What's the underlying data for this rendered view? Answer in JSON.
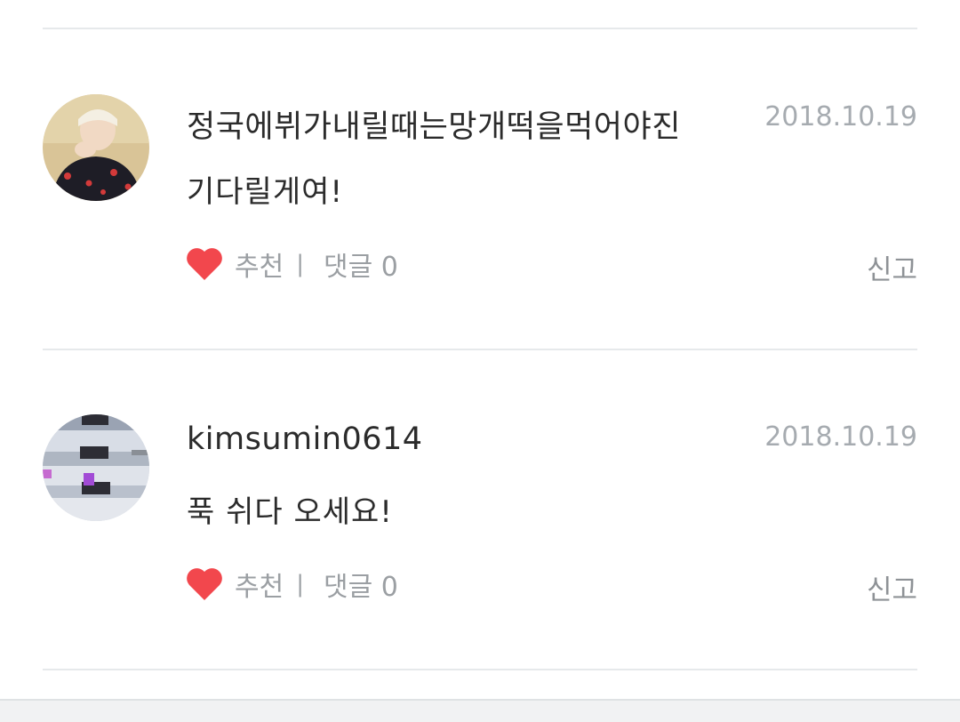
{
  "comments": [
    {
      "username": "정국에뷔가내릴때는망개떡을먹어야진",
      "date": "2018.10.19",
      "text": "기다릴게여!",
      "like_label": "추천",
      "separator": "|",
      "reply_label": "댓글 0",
      "report_label": "신고",
      "avatar": "avatar-photo-person"
    },
    {
      "username": "kimsumin0614",
      "date": "2018.10.19",
      "text": "푹 쉬다 오세요!",
      "like_label": "추천",
      "separator": "|",
      "reply_label": "댓글 0",
      "report_label": "신고",
      "avatar": "avatar-photo-landscape"
    }
  ],
  "colors": {
    "heart": "#f2474d",
    "divider": "#e6e9eb",
    "meta_text": "#9b9fa3",
    "primary_text": "#2b2b2b"
  }
}
